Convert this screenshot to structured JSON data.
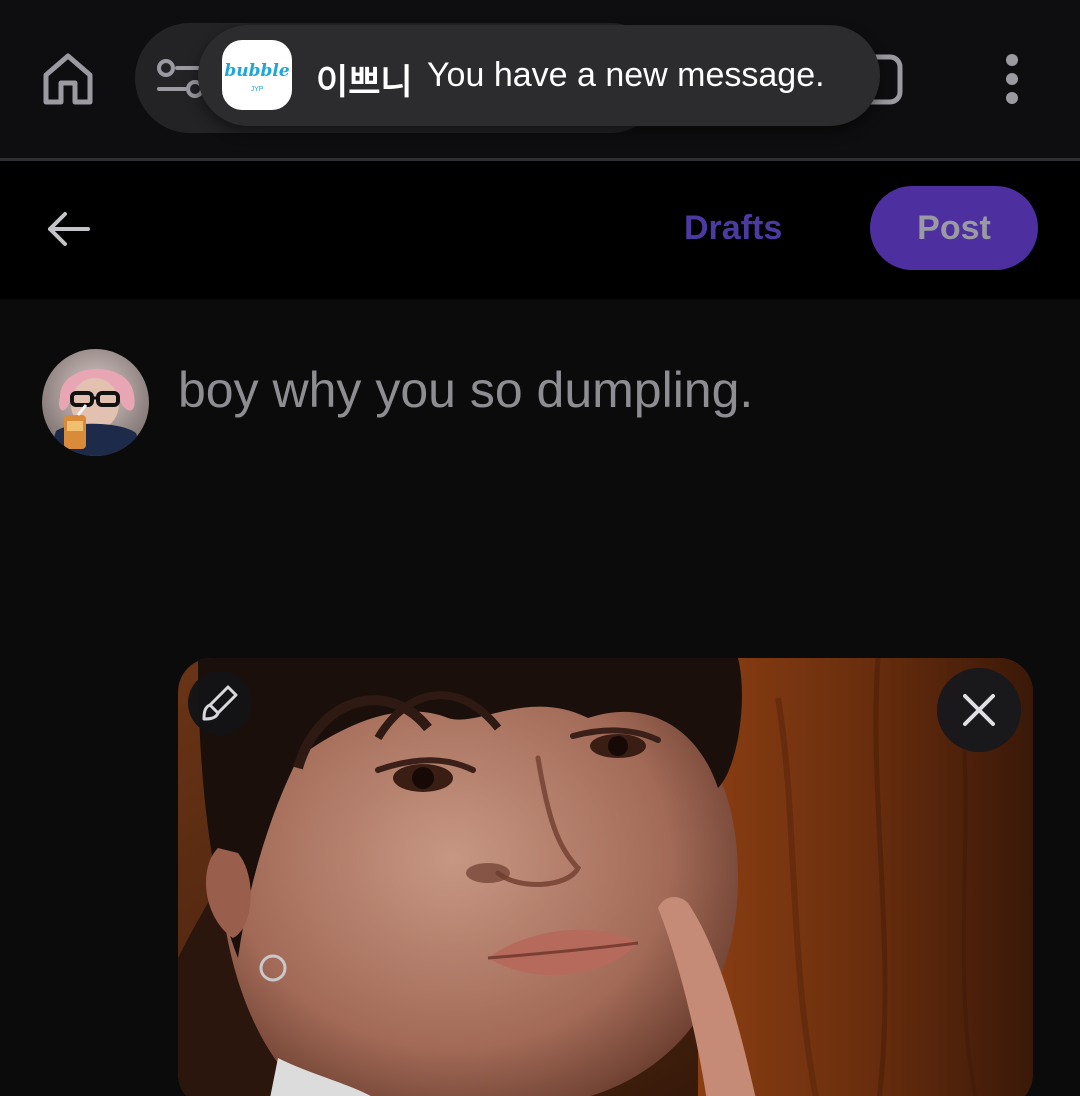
{
  "notification": {
    "app_name": "bubble",
    "app_subtitle": "JYP",
    "sender": "이쁘니",
    "message": "You have a new message."
  },
  "browser": {
    "icons": [
      "home-icon",
      "tune-icon",
      "tabs-icon",
      "more-vertical-icon"
    ]
  },
  "compose": {
    "back_icon": "arrow-left-icon",
    "drafts_label": "Drafts",
    "post_label": "Post",
    "text": "boy why you so dumpling.",
    "photo": {
      "edit_icon": "brush-icon",
      "remove_icon": "close-icon"
    }
  },
  "colors": {
    "accent": "#4e2fa0",
    "drafts": "#4c3aa0",
    "background": "#0b0b0c",
    "header": "#000000"
  }
}
